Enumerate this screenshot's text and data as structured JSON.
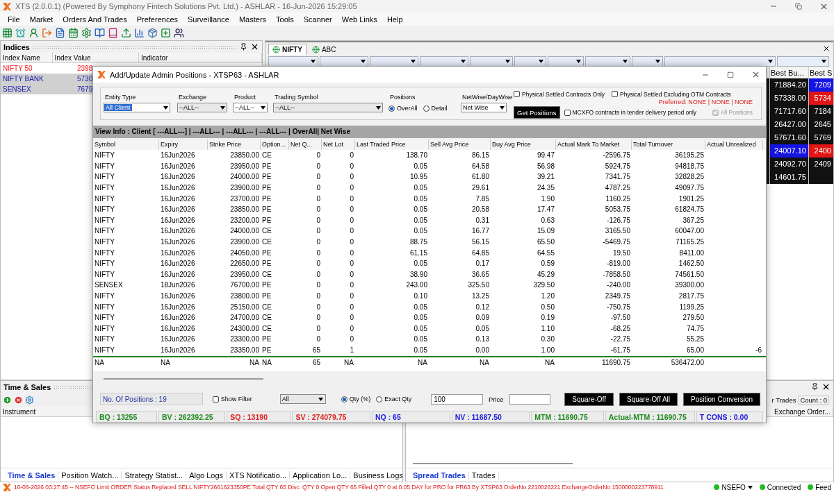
{
  "window": {
    "title": "XTS (2.0.0.1) (Powered By Symphony Fintech Solutions Pvt. Ltd.) - ASHLAR - 16-Jun-2026 15:29:05"
  },
  "menu": [
    "File",
    "Market",
    "Orders And Trades",
    "Preferences",
    "Surveillance",
    "Masters",
    "Tools",
    "Scanner",
    "Web Links",
    "Help"
  ],
  "indices": {
    "title": "Indices",
    "columns": [
      "Index Name",
      "Index Value",
      "Indicator"
    ],
    "rows": [
      {
        "name": "NIFTY 50",
        "value": "2398",
        "color": "#ff2020",
        "selected": false
      },
      {
        "name": "NIFTY BANK",
        "value": "5730",
        "color": "#2020b0",
        "selected": true
      },
      {
        "name": "SENSEX",
        "value": "7679",
        "color": "#2020b0",
        "selected": true
      }
    ]
  },
  "market_watch": {
    "tabs": [
      {
        "label": "NIFTY",
        "selected": true
      },
      {
        "label": "ABC",
        "selected": false
      }
    ],
    "columns": [
      "Best Bu...",
      "Best S"
    ],
    "rows": [
      {
        "cells": [
          {
            "text": "71884.20"
          },
          {
            "text": "7209",
            "color": "#1515e0"
          }
        ]
      },
      {
        "cells": [
          {
            "text": "57338.00"
          },
          {
            "text": "5734",
            "color": "#e01515"
          }
        ]
      },
      {
        "cells": [
          {
            "text": "71717.60"
          },
          {
            "text": "7184"
          }
        ]
      },
      {
        "cells": [
          {
            "text": "26427.00"
          },
          {
            "text": "2645"
          }
        ]
      },
      {
        "cells": [
          {
            "text": "57671.60"
          },
          {
            "text": "5769"
          }
        ]
      },
      {
        "cells": [
          {
            "text": "24007.10",
            "color": "#1515e0"
          },
          {
            "text": "2400",
            "color": "#e01515"
          }
        ]
      },
      {
        "cells": [
          {
            "text": "24092.70"
          },
          {
            "text": "2409"
          }
        ]
      },
      {
        "cells": [
          {
            "text": "14601.75"
          }
        ]
      }
    ]
  },
  "time_sales": {
    "title": "Time & Sales",
    "columns": [
      "Instrument"
    ],
    "tabs": [
      {
        "label": "Time & Sales",
        "selected": true
      },
      {
        "label": "Position Watch...",
        "selected": false
      },
      {
        "label": "Strategy Statist...",
        "selected": false
      },
      {
        "label": "Algo Logs",
        "selected": false
      },
      {
        "label": "XTS Notificatio...",
        "selected": false
      },
      {
        "label": "Application Lo...",
        "selected": false
      },
      {
        "label": "Business Logs",
        "selected": false
      }
    ]
  },
  "trades_panel": {
    "label": "r Trades",
    "count": "Count : 0",
    "columns": [
      "Exchange Order..."
    ],
    "tabs": [
      {
        "label": "Spread Trades",
        "selected": true
      },
      {
        "label": "Trades",
        "selected": false
      }
    ]
  },
  "dialog": {
    "title": "Add/Update  Admin Positions - XTSP63 - ASHLAR",
    "filters": {
      "entity_type": {
        "label": "Entity Type",
        "value": "All Client"
      },
      "exchange": {
        "label": "Exchange",
        "value": "--ALL--"
      },
      "product": {
        "label": "Product",
        "value": "--ALL--"
      },
      "trading_symbol": {
        "label": "Trading Symbol",
        "value": "--ALL--"
      },
      "positions": {
        "label": "Positions",
        "options": [
          {
            "label": "OverAll",
            "selected": true
          },
          {
            "label": "Detail",
            "selected": false
          }
        ]
      },
      "netwise": {
        "label": "NetWise/DayWise",
        "value": "Net Wise"
      },
      "checks": [
        {
          "label": "Physical Settled Contracts Only",
          "checked": false,
          "disabled": false
        },
        {
          "label": "Physical Settled Excluding OTM Contracts",
          "checked": false,
          "disabled": false
        },
        {
          "label": "MCXFO contracts in tender delivery period only",
          "checked": false,
          "disabled": false
        },
        {
          "label": "All Positions",
          "checked": true,
          "disabled": true
        }
      ],
      "preferred": "Preferred: NONE | NONE | NONE",
      "get_button": "Get Positions"
    },
    "view_info": "View Info : Client [ ---ALL---] | ---ALL--- | ---ALL--- | ---ALL--- | OverAll| Net Wise",
    "table": {
      "columns": [
        "Symbol",
        "Expiry",
        "Strike Price",
        "Option...",
        "Net Q...",
        "Net Lot",
        "Last Traded Price",
        "Sell Avg Price",
        "Buy Avg Price",
        "Actual Mark To Market",
        "Total Turnover",
        "Actual Unrealized"
      ],
      "rows": [
        [
          "NIFTY",
          "16Jun2026",
          "23850.00",
          "CE",
          "0",
          "0",
          "138.70",
          "86.15",
          "99.47",
          "-2596.75",
          "36195.25"
        ],
        [
          "NIFTY",
          "16Jun2026",
          "23950.00",
          "PE",
          "0",
          "0",
          "0.05",
          "64.58",
          "56.98",
          "5924.75",
          "94818.75"
        ],
        [
          "NIFTY",
          "16Jun2026",
          "24000.00",
          "PE",
          "0",
          "0",
          "10.95",
          "61.80",
          "39.21",
          "7341.75",
          "32828.25"
        ],
        [
          "NIFTY",
          "16Jun2026",
          "23900.00",
          "PE",
          "0",
          "0",
          "0.05",
          "29.61",
          "24.35",
          "4787.25",
          "49097.75"
        ],
        [
          "NIFTY",
          "16Jun2026",
          "23700.00",
          "PE",
          "0",
          "0",
          "0.05",
          "7.85",
          "1.90",
          "1160.25",
          "1901.25"
        ],
        [
          "NIFTY",
          "16Jun2026",
          "23850.00",
          "PE",
          "0",
          "0",
          "0.05",
          "20.58",
          "17.47",
          "5053.75",
          "61824.75"
        ],
        [
          "NIFTY",
          "16Jun2026",
          "23200.00",
          "PE",
          "0",
          "0",
          "0.05",
          "0.31",
          "0.63",
          "-126.75",
          "367.25"
        ],
        [
          "NIFTY",
          "16Jun2026",
          "24000.00",
          "CE",
          "0",
          "0",
          "0.05",
          "16.77",
          "15.09",
          "3165.50",
          "60047.00"
        ],
        [
          "NIFTY",
          "16Jun2026",
          "23900.00",
          "CE",
          "0",
          "0",
          "88.75",
          "56.15",
          "65.50",
          "-5469.75",
          "71165.25"
        ],
        [
          "NIFTY",
          "16Jun2026",
          "24050.00",
          "PE",
          "0",
          "0",
          "61.15",
          "64.85",
          "64.55",
          "19.50",
          "8411.00"
        ],
        [
          "NIFTY",
          "16Jun2026",
          "22650.00",
          "PE",
          "0",
          "0",
          "0.05",
          "0.17",
          "0.59",
          "-819.00",
          "1462.50"
        ],
        [
          "NIFTY",
          "16Jun2026",
          "23950.00",
          "CE",
          "0",
          "0",
          "38.90",
          "36.65",
          "45.29",
          "-7858.50",
          "74561.50"
        ],
        [
          "SENSEX",
          "18Jun2026",
          "76700.00",
          "PE",
          "0",
          "0",
          "243.00",
          "325.50",
          "329.50",
          "-240.00",
          "39300.00"
        ],
        [
          "NIFTY",
          "16Jun2026",
          "23800.00",
          "PE",
          "0",
          "0",
          "0.10",
          "13.25",
          "1.20",
          "2349.75",
          "2817.75"
        ],
        [
          "NIFTY",
          "16Jun2026",
          "25150.00",
          "CE",
          "0",
          "0",
          "0.05",
          "0.12",
          "0.50",
          "-750.75",
          "1199.25"
        ],
        [
          "NIFTY",
          "16Jun2026",
          "24700.00",
          "CE",
          "0",
          "0",
          "0.05",
          "0.09",
          "0.19",
          "-97.50",
          "279.50"
        ],
        [
          "NIFTY",
          "16Jun2026",
          "24300.00",
          "CE",
          "0",
          "0",
          "0.05",
          "0.05",
          "1.10",
          "-68.25",
          "74.75"
        ],
        [
          "NIFTY",
          "16Jun2026",
          "23300.00",
          "PE",
          "0",
          "0",
          "0.05",
          "0.13",
          "0.30",
          "-22.75",
          "55.25"
        ],
        [
          "NIFTY",
          "16Jun2026",
          "23350.00",
          "PE",
          "65",
          "1",
          "0.05",
          "0.00",
          "1.00",
          "-61.75",
          "65.00",
          "-6"
        ]
      ],
      "total": [
        "NA",
        "NA",
        "NA",
        "NA",
        "65",
        "NA",
        "NA",
        "NA",
        "NA",
        "11690.75",
        "536472.00"
      ]
    },
    "footer": {
      "positions": "No. Of Positions : 19",
      "show_filter": {
        "label": "Show Filter",
        "checked": false
      },
      "filter_value": "All",
      "qty_mode": [
        {
          "label": "Qty (%)",
          "selected": true
        },
        {
          "label": "Exact Qty",
          "selected": false
        }
      ],
      "qty": "100",
      "price_label": "Price",
      "buttons": [
        "Square-Off",
        "Square-Off All",
        "Position Conversion"
      ]
    },
    "stats": [
      {
        "text": "BQ : 13255",
        "color": "#208a20"
      },
      {
        "text": "BV : 262392.25",
        "color": "#208a20"
      },
      {
        "text": "SQ : 13190",
        "color": "#e02020"
      },
      {
        "text": "SV : 274079.75",
        "color": "#e02020"
      },
      {
        "text": "NQ : 65",
        "color": "#2020e0"
      },
      {
        "text": "NV : 11687.50",
        "color": "#2020e0"
      },
      {
        "text": "MTM : 11690.75",
        "color": "#208a20"
      },
      {
        "text": "Actual-MTM : 11690.75",
        "color": "#208a20"
      },
      {
        "text": "T CONS : 0.00",
        "color": "#2020e0"
      }
    ]
  },
  "status_bar": {
    "message": "16-06-2026 03:27:45 -- NSEFO Limit  ORDER Status Replaced   SELL NIFTY2661623350PE  Total QTY 65  Disc. QTY 0  Open QTY 65  Filled QTY 0  at 0.05 DAY for PRO for PR63 By XTSP63 OrderNo 2210026221 ExchangeOrderNo 1500000223778911",
    "indicators": [
      {
        "label": "NSEFO",
        "color": "#22bb22",
        "dropdown": true
      },
      {
        "label": "Connected",
        "color": "#22bb22",
        "dropdown": false
      },
      {
        "label": "Feed",
        "color": "#22bb22",
        "dropdown": false
      }
    ]
  }
}
